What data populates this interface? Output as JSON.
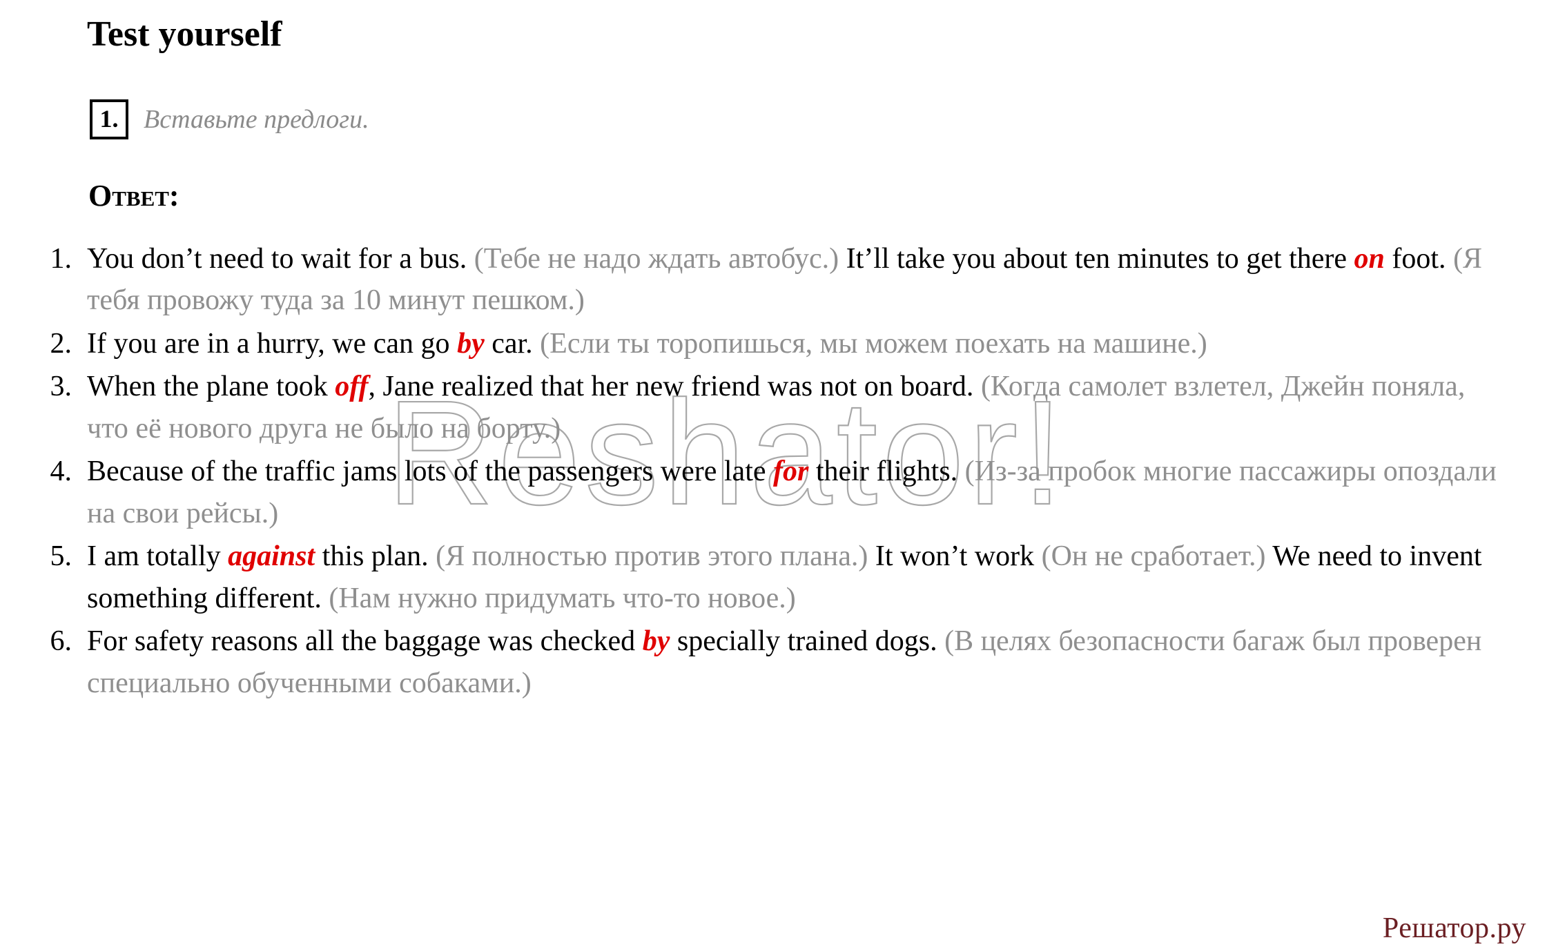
{
  "header": {
    "title": "Test yourself",
    "task_number": "1.",
    "task_instruction": "Вставьте предлоги.",
    "answer_label": "Ответ:"
  },
  "watermark": {
    "text": "Reshator!",
    "color": "#a8a8a8"
  },
  "colors": {
    "english_text": "#000000",
    "russian_translation": "#8f8f8f",
    "answer_key": "#e00000",
    "logo": "#6b1f23"
  },
  "answers": [
    {
      "marker": "1.",
      "segments": [
        {
          "type": "en",
          "text": "You don’t need to wait for a bus. "
        },
        {
          "type": "ru",
          "text": "(Тебе не надо ждать автобус.) "
        },
        {
          "type": "en",
          "text": "It’ll take you about ten minutes to get there "
        },
        {
          "type": "key",
          "text": "on"
        },
        {
          "type": "en",
          "text": " foot. "
        },
        {
          "type": "ru",
          "text": "(Я тебя провожу туда за 10 минут пешком.)"
        }
      ]
    },
    {
      "marker": "2.",
      "segments": [
        {
          "type": "en",
          "text": "If you are in a hurry, we can go "
        },
        {
          "type": "key",
          "text": "by"
        },
        {
          "type": "en",
          "text": " car. "
        },
        {
          "type": "ru",
          "text": "(Если ты торопишься, мы можем поехать на машине.)"
        }
      ]
    },
    {
      "marker": "3.",
      "segments": [
        {
          "type": "en",
          "text": "When the plane took "
        },
        {
          "type": "key",
          "text": "off"
        },
        {
          "type": "en",
          "text": ", Jane realized that her new friend was not on board. "
        },
        {
          "type": "ru",
          "text": "(Когда самолет взлетел, Джейн поняла, что её нового друга не было на борту.)"
        }
      ]
    },
    {
      "marker": "4.",
      "segments": [
        {
          "type": "en",
          "text": "Because of the traffic jams lots of the passengers were late "
        },
        {
          "type": "key",
          "text": "for"
        },
        {
          "type": "en",
          "text": " their flights. "
        },
        {
          "type": "ru",
          "text": "(Из-за пробок многие пассажиры опоздали на свои рейсы.)"
        }
      ]
    },
    {
      "marker": "5.",
      "segments": [
        {
          "type": "en",
          "text": "I am totally "
        },
        {
          "type": "key",
          "text": "against"
        },
        {
          "type": "en",
          "text": "  this plan. "
        },
        {
          "type": "ru",
          "text": "(Я полностью против этого плана.) "
        },
        {
          "type": "en",
          "text": "It won’t work "
        },
        {
          "type": "ru",
          "text": "(Он не сработает.) "
        },
        {
          "type": "en",
          "text": "We need to invent something different. "
        },
        {
          "type": "ru",
          "text": "(Нам нужно придумать что-то новое.)"
        }
      ]
    },
    {
      "marker": "6.",
      "segments": [
        {
          "type": "en",
          "text": "For safety reasons all the baggage was checked "
        },
        {
          "type": "key",
          "text": "by"
        },
        {
          "type": "en",
          "text": " specially trained dogs. "
        },
        {
          "type": "ru",
          "text": "(В целях безопасности багаж был проверен специально обученными собаками.)"
        }
      ]
    }
  ],
  "footer": {
    "logo": "Решатор.ру"
  }
}
